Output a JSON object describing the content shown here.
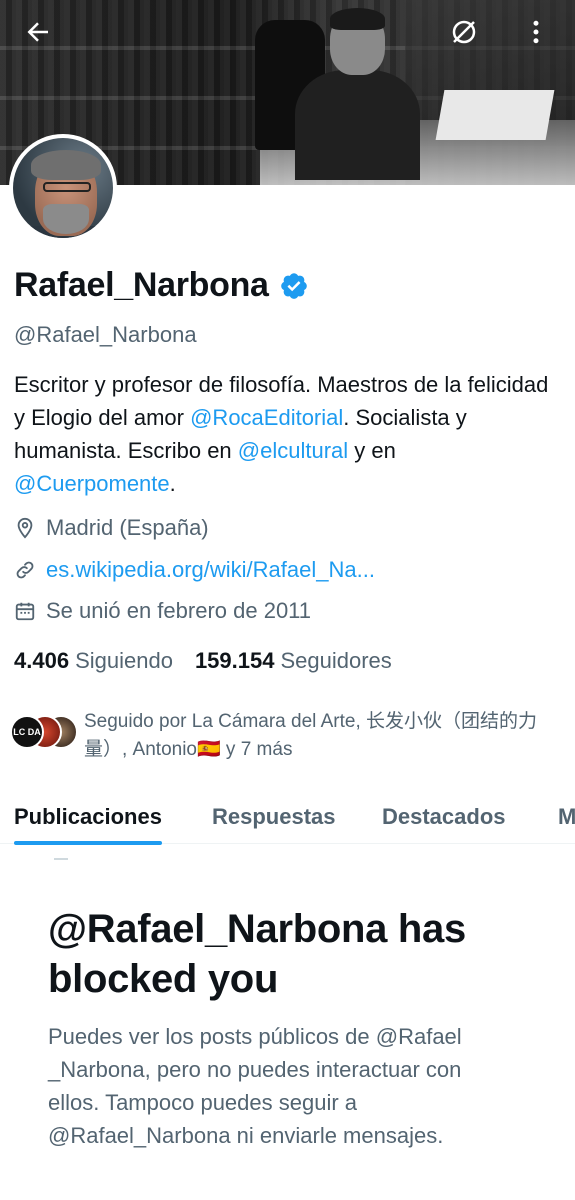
{
  "header": {
    "back_icon": "arrow-left-icon",
    "mute_icon": "slash-circle-icon",
    "more_icon": "vertical-ellipsis-icon"
  },
  "profile": {
    "display_name": "Rafael_Narbona",
    "verified": true,
    "handle": "@Rafael_Narbona",
    "bio": {
      "part1": "Escritor y profesor de filosofía. Maestros de la felicidad y Elogio del amor ",
      "mention1": "@RocaEditorial",
      "part2": ". Socialista y humanista. Escribo en ",
      "mention2": "@elcultural",
      "part3": " y en ",
      "mention3": "@Cuerpomente",
      "part4": "."
    },
    "location": "Madrid (España)",
    "link": "es.wikipedia.org/wiki/Rafael_Na...",
    "joined": "Se unió en febrero de 2011",
    "following_count": "4.406",
    "following_label": "Siguiendo",
    "followers_count": "159.154",
    "followers_label": "Seguidores",
    "followed_by": "Seguido por La Cámara del Arte, 长发小伙（团结的力量）, Antonio🇪🇸 y 7 más",
    "mini_avatar_text": "LC DA"
  },
  "tabs": [
    {
      "label": "Publicaciones",
      "active": true
    },
    {
      "label": "Respuestas",
      "active": false
    },
    {
      "label": "Destacados",
      "active": false
    },
    {
      "label": "M",
      "active": false
    }
  ],
  "blocked": {
    "title": "@Rafael_Narbona has blocked you",
    "body": "Puedes ver los posts públicos de @Rafael _Narbona, pero no puedes interactuar con ellos. Tampoco puedes seguir a @Rafael_Narbona ni enviarle mensajes."
  },
  "colors": {
    "accent": "#1d9bf0",
    "text_primary": "#0f1419",
    "text_secondary": "#536471"
  }
}
